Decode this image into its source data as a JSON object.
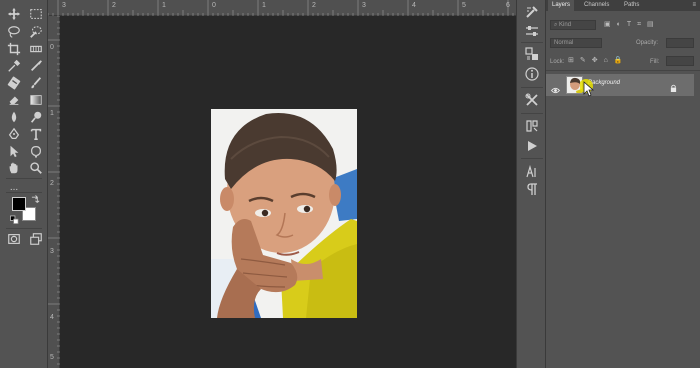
{
  "toolbar": {
    "tools": [
      "move-tool",
      "marquee-tool",
      "lasso-tool",
      "quick-selection-tool",
      "crop-tool",
      "frame-tool",
      "eyedropper-tool",
      "healing-brush-tool",
      "brush-tool",
      "clone-stamp-tool",
      "history-brush-tool",
      "eraser-tool",
      "gradient-tool",
      "blur-tool",
      "dodge-tool",
      "pen-tool",
      "type-tool",
      "path-selection-tool",
      "rectangle-tool",
      "hand-tool",
      "zoom-tool",
      "edit-toolbar",
      "foreground-color",
      "background-color",
      "quick-mask",
      "screen-mode"
    ],
    "foreground_color": "#000000",
    "background_color": "#ffffff",
    "more_label": "..."
  },
  "rulers": {
    "top_ticks": [
      "3",
      "2",
      "1",
      "0",
      "1",
      "2",
      "3",
      "4",
      "5",
      "6",
      "7"
    ],
    "left_ticks": [
      "0",
      "1",
      "2",
      "3",
      "4",
      "5"
    ]
  },
  "panel_strip": {
    "icons": [
      "brush-settings-icon",
      "adjustments-icon",
      "libraries-icon",
      "info-icon",
      "tools-icon",
      "color-icon",
      "play-icon",
      "character-icon",
      "paragraph-icon"
    ]
  },
  "layers_panel": {
    "tabs": [
      "Layers",
      "Channels",
      "Paths"
    ],
    "active_tab": "Layers",
    "filter_placeholder": "Kind",
    "blend_mode": "Normal",
    "opacity_label": "Opacity:",
    "lock_label": "Lock:",
    "fill_label": "Fill:",
    "layers": [
      {
        "name": "Background",
        "visible": true,
        "locked": true,
        "selected": true
      }
    ]
  },
  "colors": {
    "ui_bg": "#535353",
    "canvas_bg": "#282828",
    "selected_layer": "#6d6d6d",
    "cursor_highlight": "#e8e000"
  }
}
